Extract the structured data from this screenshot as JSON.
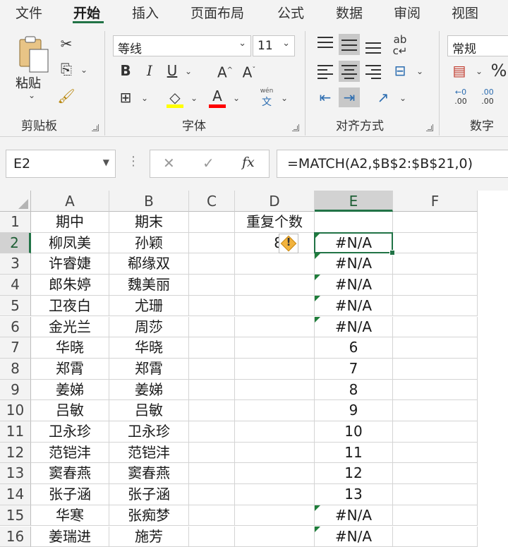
{
  "tabs": [
    "文件",
    "开始",
    "插入",
    "页面布局",
    "公式",
    "数据",
    "审阅",
    "视图"
  ],
  "active_tab": "开始",
  "ribbon": {
    "clipboard": {
      "paste_label": "粘贴",
      "group_label": "剪贴板"
    },
    "font": {
      "font_name": "等线",
      "font_size": "11",
      "bold": "B",
      "italic": "I",
      "underline": "U",
      "grow": "A",
      "shrink": "A",
      "phonetic_top": "wén",
      "phonetic_bottom": "文",
      "group_label": "字体",
      "fill_color": "#ffff00",
      "font_color": "#ff0000"
    },
    "alignment": {
      "group_label": "对齐方式",
      "wrap": "ab/c"
    },
    "number": {
      "format": "常规",
      "percent": "%",
      "group_label": "数字",
      "inc_decimal": ".00",
      "dec_decimal": ".00"
    }
  },
  "formula_bar": {
    "name_box": "E2",
    "cancel": "✕",
    "enter": "✓",
    "fx": "fx",
    "formula": "=MATCH(A2,$B$2:$B$21,0)"
  },
  "sheet": {
    "columns": [
      "A",
      "B",
      "C",
      "D",
      "E",
      "F"
    ],
    "active_column": "E",
    "active_row": "2",
    "rows": [
      {
        "n": "1",
        "A": "期中",
        "B": "期末",
        "C": "",
        "D": "重复个数",
        "E": "",
        "tri": false
      },
      {
        "n": "2",
        "A": "柳凤美",
        "B": "孙颖",
        "C": "",
        "D": "8",
        "E": "#N/A",
        "tri": true
      },
      {
        "n": "3",
        "A": "许睿婕",
        "B": "郗缘双",
        "C": "",
        "D": "",
        "E": "#N/A",
        "tri": true
      },
      {
        "n": "4",
        "A": "郎朱婷",
        "B": "魏美丽",
        "C": "",
        "D": "",
        "E": "#N/A",
        "tri": true
      },
      {
        "n": "5",
        "A": "卫夜白",
        "B": "尤珊",
        "C": "",
        "D": "",
        "E": "#N/A",
        "tri": true
      },
      {
        "n": "6",
        "A": "金光兰",
        "B": "周莎",
        "C": "",
        "D": "",
        "E": "#N/A",
        "tri": true
      },
      {
        "n": "7",
        "A": "华晓",
        "B": "华晓",
        "C": "",
        "D": "",
        "E": "6",
        "tri": false
      },
      {
        "n": "8",
        "A": "郑霄",
        "B": "郑霄",
        "C": "",
        "D": "",
        "E": "7",
        "tri": false
      },
      {
        "n": "9",
        "A": "姜娣",
        "B": "姜娣",
        "C": "",
        "D": "",
        "E": "8",
        "tri": false
      },
      {
        "n": "10",
        "A": "吕敏",
        "B": "吕敏",
        "C": "",
        "D": "",
        "E": "9",
        "tri": false
      },
      {
        "n": "11",
        "A": "卫永珍",
        "B": "卫永珍",
        "C": "",
        "D": "",
        "E": "10",
        "tri": false
      },
      {
        "n": "12",
        "A": "范铠沣",
        "B": "范铠沣",
        "C": "",
        "D": "",
        "E": "11",
        "tri": false
      },
      {
        "n": "13",
        "A": "窦春燕",
        "B": "窦春燕",
        "C": "",
        "D": "",
        "E": "12",
        "tri": false
      },
      {
        "n": "14",
        "A": "张子涵",
        "B": "张子涵",
        "C": "",
        "D": "",
        "E": "13",
        "tri": false
      },
      {
        "n": "15",
        "A": "华寒",
        "B": "张痴梦",
        "C": "",
        "D": "",
        "E": "#N/A",
        "tri": true
      },
      {
        "n": "16",
        "A": "姜瑞进",
        "B": "施芳",
        "C": "",
        "D": "",
        "E": "#N/A",
        "tri": true
      }
    ],
    "error_indicator": "!"
  }
}
